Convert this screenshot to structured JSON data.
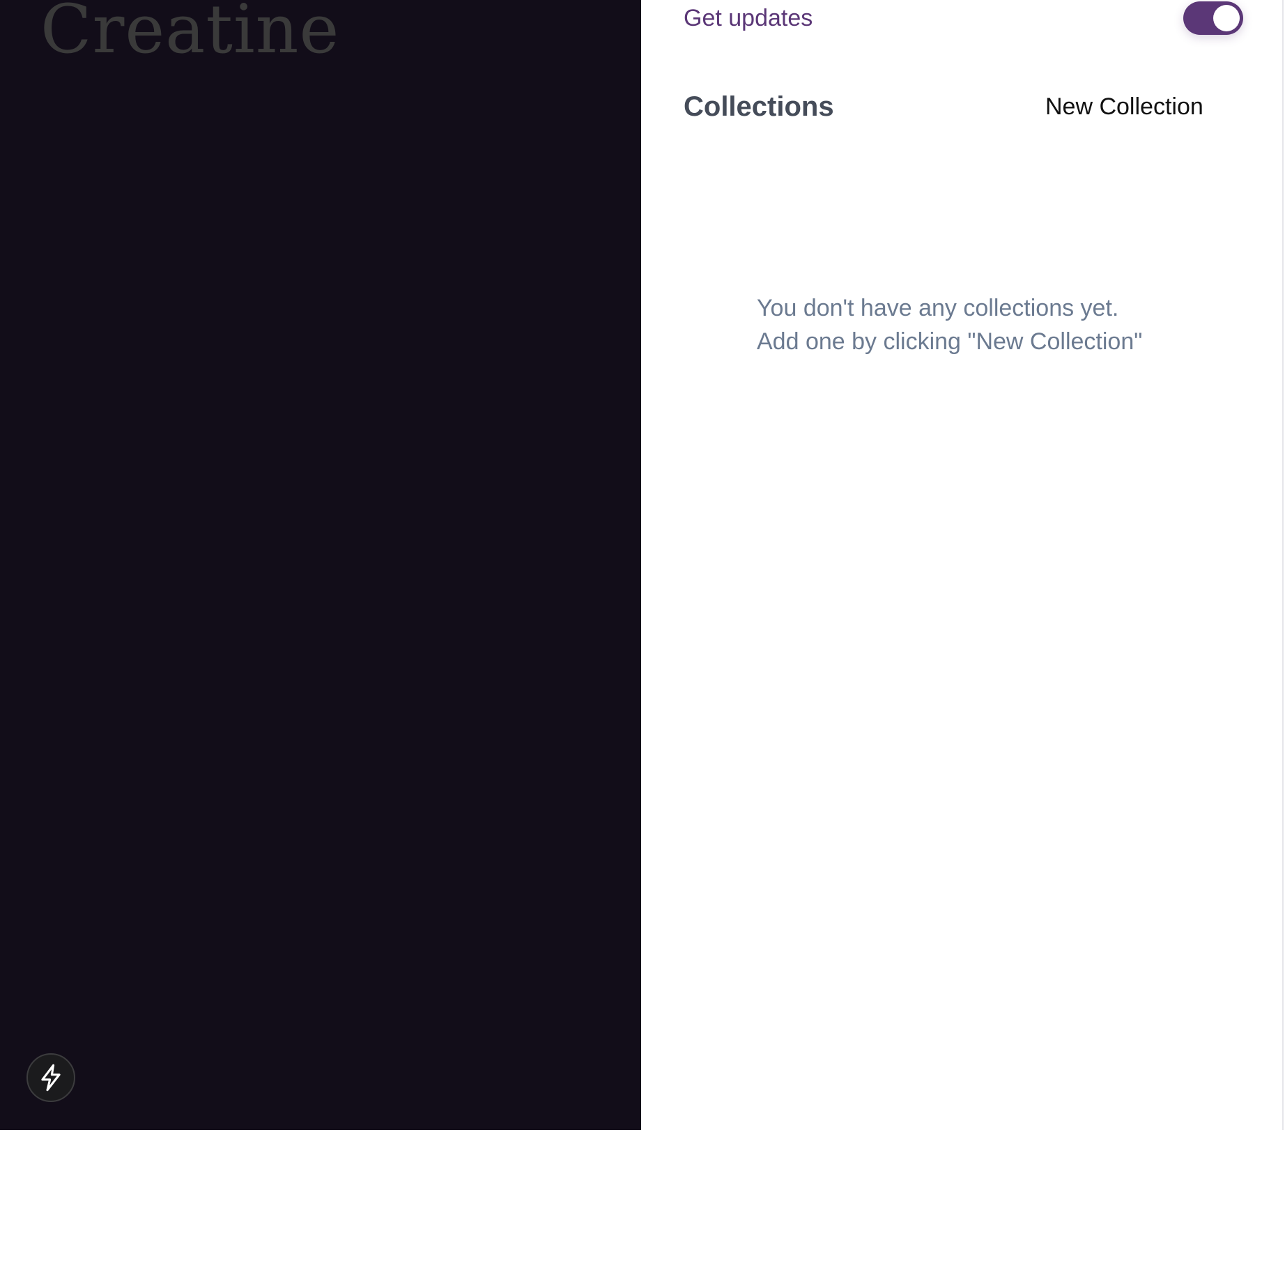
{
  "brand": {
    "title": "Creatine"
  },
  "settings": {
    "updates_label": "Get updates",
    "updates_enabled": true
  },
  "collections": {
    "title": "Collections",
    "new_button_label": "New Collection",
    "empty_message_line1": "You don't have any collections yet.",
    "empty_message_line2": "Add one by clicking \"New Collection\""
  },
  "icons": {
    "action_badge": "lightning-bolt-icon"
  },
  "colors": {
    "dark_panel": "#120d19",
    "accent": "#5b3777",
    "muted_text": "#6b7a90",
    "heading_text": "#454c59"
  }
}
